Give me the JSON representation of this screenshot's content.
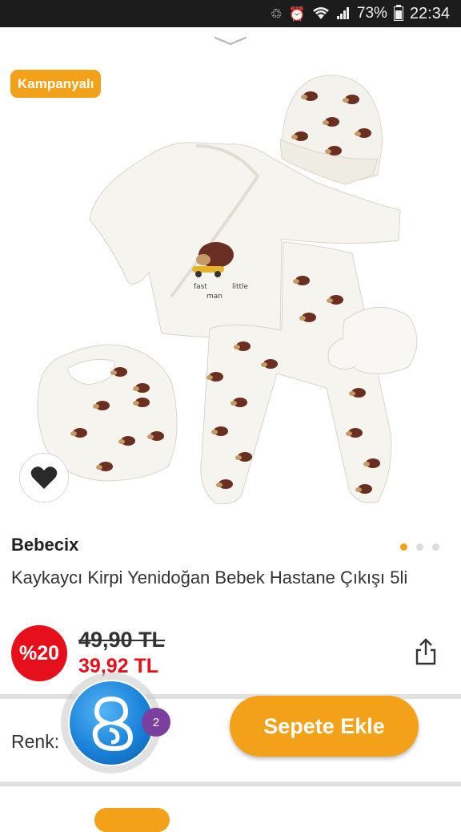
{
  "status_bar": {
    "battery": "73%",
    "time": "22:34",
    "icons": [
      "recycle-icon",
      "alarm-icon",
      "wifi-icon",
      "signal-icon",
      "battery-icon"
    ]
  },
  "product": {
    "campaign_badge": "Kampanyalı",
    "brand": "Bebecix",
    "title": "Kaykaycı Kirpi Yenidoğan Bebek Hastane Çıkışı 5li",
    "discount": "%20",
    "old_price": "49,90 TL",
    "new_price": "39,92 TL",
    "image_count": 3,
    "active_image": 1,
    "image_print_words": [
      "fast",
      "little",
      "man"
    ]
  },
  "actions": {
    "color_label": "Renk:",
    "add_to_cart": "Sepete Ekle",
    "assistant_notifications": "2"
  },
  "colors": {
    "accent": "#f4a11a",
    "discount": "#e5101c",
    "assistant_blue": "#1a82d9",
    "badge_purple": "#7b3fa0"
  }
}
